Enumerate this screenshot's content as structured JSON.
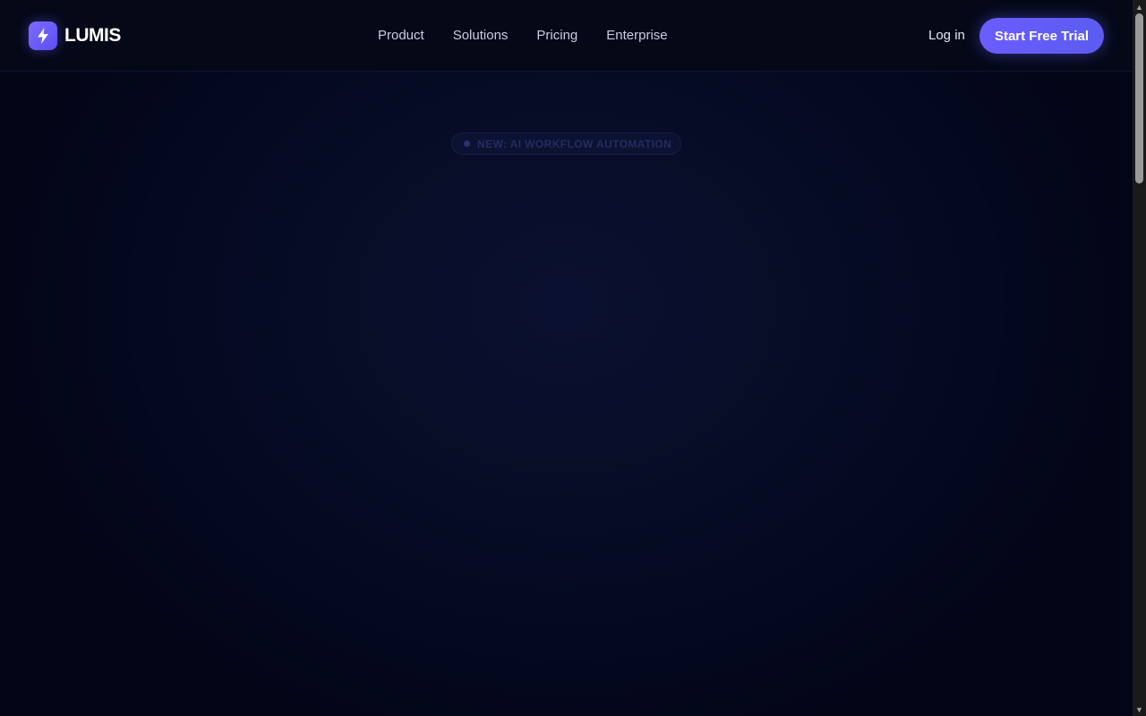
{
  "brand": {
    "name": "LUMIS",
    "icon": "lightning-bolt-icon"
  },
  "nav": {
    "links": [
      "Product",
      "Solutions",
      "Pricing",
      "Enterprise"
    ],
    "login_label": "Log in",
    "cta_label": "Start Free Trial"
  },
  "hero": {
    "badge_text": "NEW: AI WORKFLOW AUTOMATION"
  },
  "colors": {
    "accent": "#6a5cff",
    "background": "#030616"
  }
}
